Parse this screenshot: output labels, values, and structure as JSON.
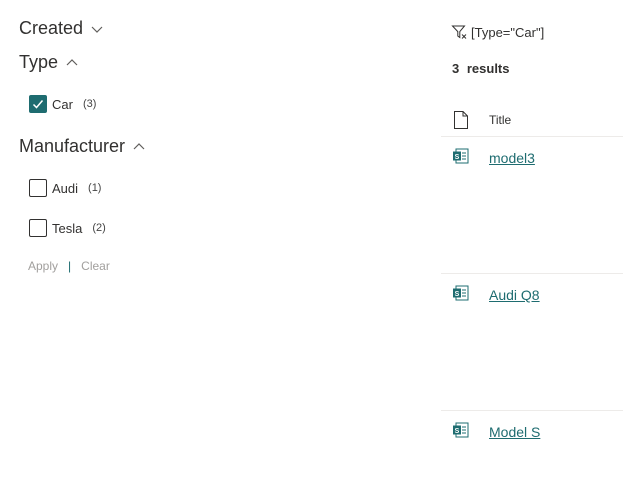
{
  "refiners": {
    "created": {
      "label": "Created"
    },
    "type": {
      "label": "Type",
      "options": [
        {
          "label": "Car",
          "count": "(3)",
          "checked": true
        }
      ]
    },
    "manufacturer": {
      "label": "Manufacturer",
      "options": [
        {
          "label": "Audi",
          "count": "(1)",
          "checked": false
        },
        {
          "label": "Tesla",
          "count": "(2)",
          "checked": false
        }
      ]
    },
    "actions": {
      "apply": "Apply",
      "separator": "|",
      "clear": "Clear"
    }
  },
  "results": {
    "filter_text": "[Type=\"Car\"]",
    "count_number": "3",
    "count_label": "results",
    "column_title": "Title",
    "items": [
      {
        "title": "model3"
      },
      {
        "title": "Audi Q8"
      },
      {
        "title": "Model S"
      }
    ]
  },
  "colors": {
    "accent": "#1e6c70",
    "text": "#323130",
    "muted": "#a19f9d"
  },
  "icons": [
    "chevron-down-icon",
    "chevron-up-icon",
    "checkmark-icon",
    "filter-icon",
    "file-icon",
    "sharepoint-doc-icon"
  ]
}
